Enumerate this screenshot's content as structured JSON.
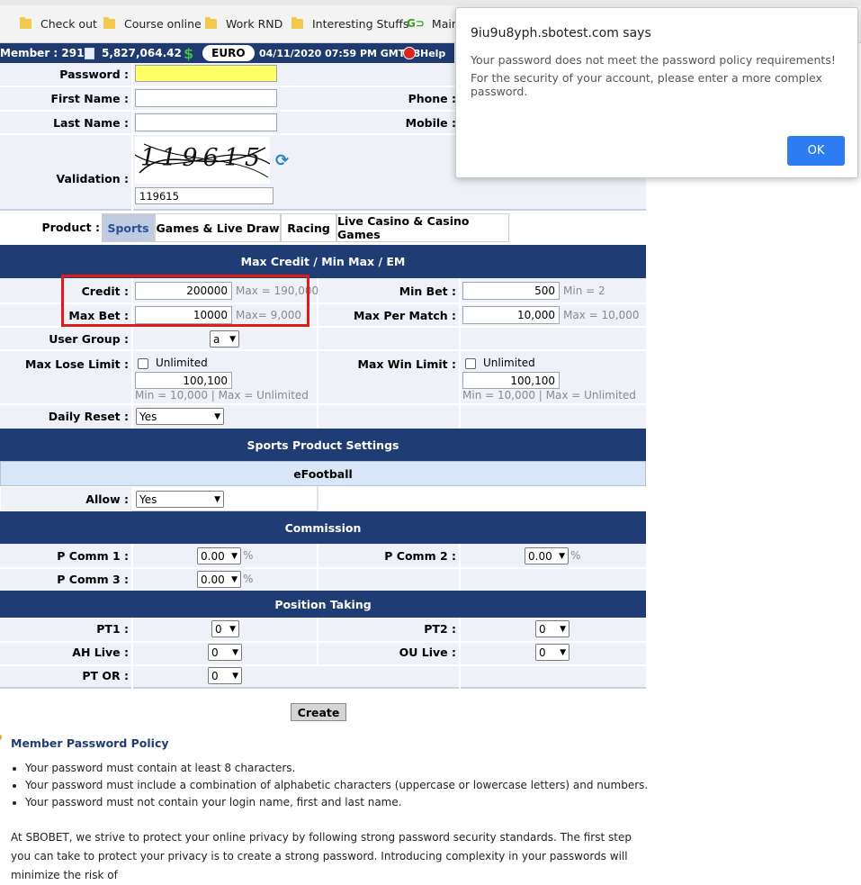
{
  "bookmarks": [
    {
      "label": "Check out",
      "icon": "folder-icon"
    },
    {
      "label": "Course online",
      "icon": "folder-icon"
    },
    {
      "label": "Work RND",
      "icon": "folder-icon"
    },
    {
      "label": "Interesting Stuffs",
      "icon": "folder-icon"
    },
    {
      "label": "Main",
      "icon": "go-icon"
    }
  ],
  "status": {
    "member": "Member : 291",
    "balance": "5,827,064.42",
    "currency": "EURO",
    "datetime": "04/11/2020 07:59 PM GMT+8",
    "help": "Help"
  },
  "form": {
    "password_label": "Password :",
    "password_value": "",
    "first_name_label": "First Name :",
    "first_name_value": "",
    "phone_label": "Phone :",
    "last_name_label": "Last Name :",
    "last_name_value": "",
    "mobile_label": "Mobile :",
    "validation_label": "Validation :",
    "captcha_text": "119615",
    "captcha_input": "119615"
  },
  "product": {
    "label": "Product :",
    "tabs": [
      "Sports",
      "Games & Live Draw",
      "Racing",
      "Live Casino & Casino Games"
    ],
    "active": "Sports"
  },
  "max_credit": {
    "header": "Max Credit / Min Max / EM",
    "credit_label": "Credit :",
    "credit_value": "200000",
    "credit_hint": "Max = 190,000",
    "max_bet_label": "Max Bet :",
    "max_bet_value": "10000",
    "max_bet_hint": "Max= 9,000",
    "min_bet_label": "Min Bet :",
    "min_bet_value": "500",
    "min_bet_hint": "Min = 2",
    "max_per_match_label": "Max Per Match :",
    "max_per_match_value": "10,000",
    "max_per_match_hint": "Max = 10,000",
    "user_group_label": "User Group :",
    "user_group_value": "a",
    "max_lose_label": "Max Lose Limit :",
    "max_lose_unlimited": "Unlimited",
    "max_lose_value": "100,100",
    "max_lose_hint": "Min = 10,000 | Max = Unlimited",
    "max_win_label": "Max Win Limit :",
    "max_win_unlimited": "Unlimited",
    "max_win_value": "100,100",
    "max_win_hint": "Min = 10,000 | Max = Unlimited",
    "daily_reset_label": "Daily Reset :",
    "daily_reset_value": "Yes"
  },
  "sports_settings": {
    "header": "Sports Product Settings",
    "subheader": "eFootball",
    "allow_label": "Allow :",
    "allow_value": "Yes"
  },
  "commission": {
    "header": "Commission",
    "p1_label": "P Comm 1 :",
    "p1_value": "0.00",
    "p2_label": "P Comm 2 :",
    "p2_value": "0.00",
    "p3_label": "P Comm 3 :",
    "p3_value": "0.00",
    "unit": "%"
  },
  "position": {
    "header": "Position Taking",
    "pt1_label": "PT1 :",
    "pt1_value": "0",
    "pt2_label": "PT2 :",
    "pt2_value": "0",
    "ah_label": "AH Live :",
    "ah_value": "0",
    "ou_label": "OU Live :",
    "ou_value": "0",
    "ptor_label": "PT OR :",
    "ptor_value": "0"
  },
  "create_label": "Create",
  "policy": {
    "title": "Member Password Policy",
    "items": [
      "Your password must contain at least 8 characters.",
      "Your password must include a combination of alphabetic characters (uppercase or lowercase letters) and numbers.",
      "Your password must not contain your login name, first and last name."
    ],
    "text": "At SBOBET, we strive to protect your online privacy by following strong password security standards. The first step you can take to protect your privacy is to create a strong password. Introducing complexity in your passwords will minimize the risk of"
  },
  "dialog": {
    "title": "9iu9u8yph.sbotest.com says",
    "line1": "Your password does not meet the password policy requirements!",
    "line2": "For the security of your account, please enter a more complex password.",
    "ok": "OK"
  },
  "colors": {
    "header_navy": "#1f3c74",
    "highlight_yellow": "#ffff66",
    "alert_red": "#e01b1b",
    "ok_blue": "#2d7cf2"
  }
}
